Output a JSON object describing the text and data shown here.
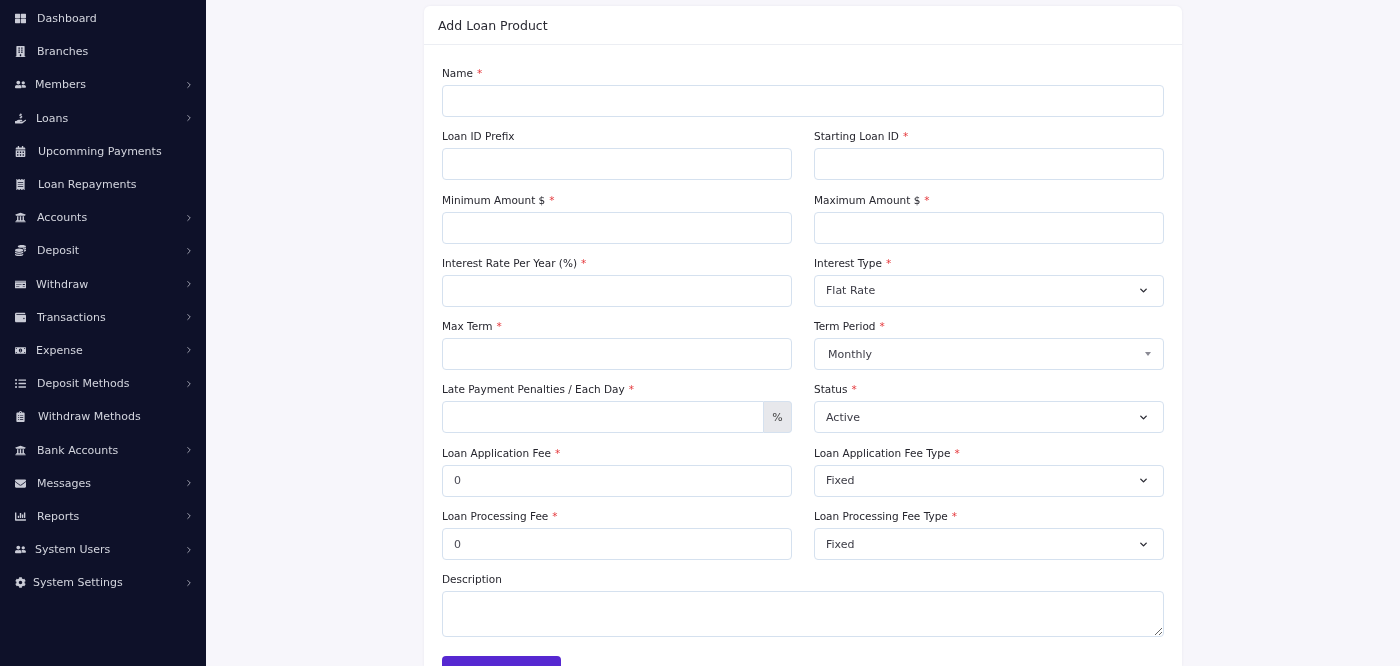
{
  "sidebar": {
    "items": [
      {
        "label": "Dashboard",
        "expandable": false
      },
      {
        "label": "Branches",
        "expandable": false
      },
      {
        "label": "Members",
        "expandable": true
      },
      {
        "label": "Loans",
        "expandable": true
      },
      {
        "label": "Upcomming Payments",
        "expandable": false
      },
      {
        "label": "Loan Repayments",
        "expandable": false
      },
      {
        "label": "Accounts",
        "expandable": true
      },
      {
        "label": "Deposit",
        "expandable": true
      },
      {
        "label": "Withdraw",
        "expandable": true
      },
      {
        "label": "Transactions",
        "expandable": true
      },
      {
        "label": "Expense",
        "expandable": true
      },
      {
        "label": "Deposit Methods",
        "expandable": true
      },
      {
        "label": "Withdraw Methods",
        "expandable": false
      },
      {
        "label": "Bank Accounts",
        "expandable": true
      },
      {
        "label": "Messages",
        "expandable": true
      },
      {
        "label": "Reports",
        "expandable": true
      },
      {
        "label": "System Users",
        "expandable": true
      },
      {
        "label": "System Settings",
        "expandable": true
      }
    ]
  },
  "card": {
    "title": "Add Loan Product",
    "rows": [
      {
        "fields": [
          {
            "kind": "text",
            "label": "Name",
            "marker": "*"
          }
        ]
      },
      {
        "fields": [
          {
            "kind": "text",
            "label": "Loan ID Prefix"
          },
          {
            "kind": "text",
            "label": "Starting Loan ID",
            "marker": "*"
          }
        ]
      },
      {
        "fields": [
          {
            "kind": "text",
            "label": "Minimum Amount $",
            "marker": "*"
          },
          {
            "kind": "text",
            "label": "Maximum Amount $",
            "marker": "*"
          }
        ]
      },
      {
        "fields": [
          {
            "kind": "text",
            "label": "Interest Rate Per Year (%)",
            "marker": "*"
          },
          {
            "kind": "select",
            "label": "Interest Type",
            "marker": "*",
            "value": "Flat Rate"
          }
        ]
      },
      {
        "fields": [
          {
            "kind": "text",
            "label": "Max Term",
            "marker": "*"
          },
          {
            "kind": "combo",
            "label": "Term Period",
            "marker": "*",
            "value": "Monthly"
          }
        ]
      },
      {
        "fields": [
          {
            "kind": "addon",
            "label": "Late Payment Penalties / Each Day",
            "marker": "*",
            "addon": "%"
          },
          {
            "kind": "select",
            "label": "Status",
            "marker": "*",
            "value": "Active"
          }
        ]
      },
      {
        "fields": [
          {
            "kind": "text",
            "label": "Loan Application Fee",
            "marker": "*",
            "value": "0"
          },
          {
            "kind": "select",
            "label": "Loan Application Fee Type",
            "marker": "*",
            "value": "Fixed"
          }
        ]
      },
      {
        "fields": [
          {
            "kind": "text",
            "label": "Loan Processing Fee",
            "marker": "*",
            "value": "0"
          },
          {
            "kind": "select",
            "label": "Loan Processing Fee Type",
            "marker": "*",
            "value": "Fixed"
          }
        ]
      },
      {
        "fields": [
          {
            "kind": "textarea",
            "label": "Description"
          }
        ]
      }
    ]
  }
}
